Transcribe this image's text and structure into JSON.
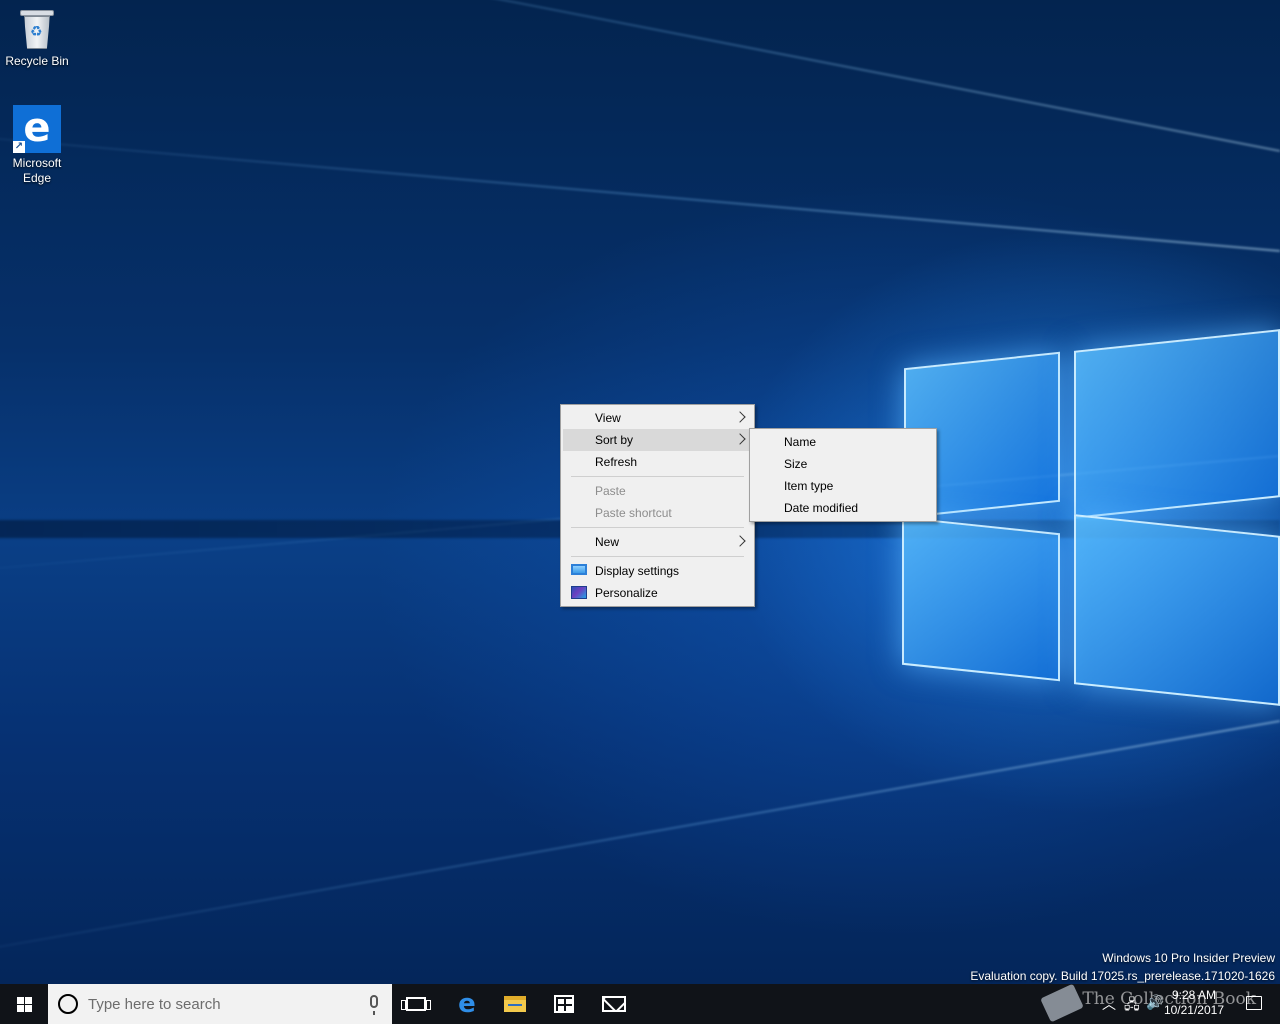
{
  "desktop": {
    "icons": [
      {
        "label": "Recycle Bin",
        "icon": "recycle-bin-icon"
      },
      {
        "label": "Microsoft Edge",
        "icon": "edge-icon"
      }
    ]
  },
  "context_menu": {
    "items": [
      {
        "label": "View",
        "submenu": true,
        "enabled": true
      },
      {
        "label": "Sort by",
        "submenu": true,
        "enabled": true,
        "highlighted": true
      },
      {
        "label": "Refresh",
        "submenu": false,
        "enabled": true
      },
      {
        "label": "Paste",
        "submenu": false,
        "enabled": false
      },
      {
        "label": "Paste shortcut",
        "submenu": false,
        "enabled": false
      },
      {
        "label": "New",
        "submenu": true,
        "enabled": true
      },
      {
        "label": "Display settings",
        "submenu": false,
        "enabled": true,
        "icon": "monitor-icon"
      },
      {
        "label": "Personalize",
        "submenu": false,
        "enabled": true,
        "icon": "personalize-icon"
      }
    ]
  },
  "sort_submenu": {
    "items": [
      "Name",
      "Size",
      "Item type",
      "Date modified"
    ]
  },
  "watermark": {
    "line1": "Windows 10 Pro Insider Preview",
    "line2": "Evaluation copy. Build 17025.rs_prerelease.171020-1626"
  },
  "taskbar": {
    "search_placeholder": "Type here to search",
    "time": "9:28 AM",
    "date": "10/21/2017",
    "brand": "The Collection Book",
    "colors": {
      "background": "#101318",
      "edge": "#2f8ee8"
    }
  }
}
